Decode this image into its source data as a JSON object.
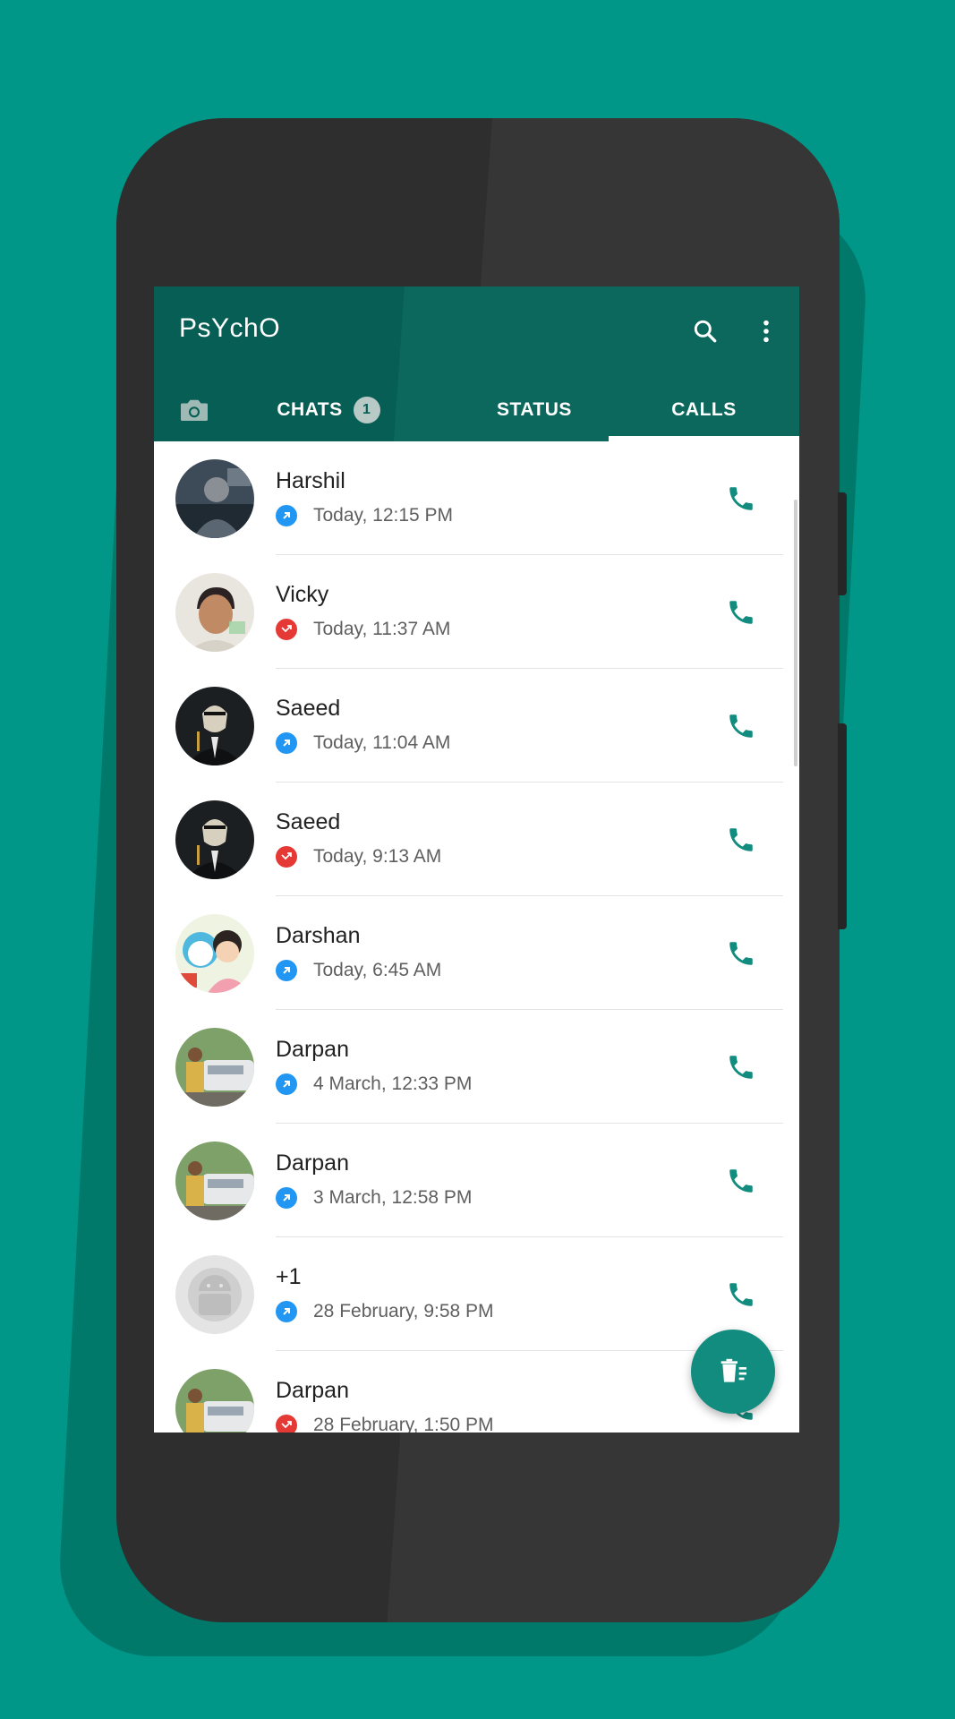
{
  "app": {
    "title": "PsYchO",
    "colors": {
      "primary": "#075e54",
      "accent": "#128c7e",
      "background": "#009688",
      "missed": "#e53935",
      "outgoing": "#2196f3"
    }
  },
  "toolbar": {
    "icons": [
      "search-icon",
      "more-vert-icon"
    ]
  },
  "tabs": {
    "camera_icon": "camera-icon",
    "items": [
      {
        "label": "CHATS",
        "badge": "1"
      },
      {
        "label": "STATUS"
      },
      {
        "label": "CALLS",
        "selected": true
      }
    ]
  },
  "calls": [
    {
      "name": "Harshil",
      "time": "Today, 12:15 PM",
      "direction": "outgoing",
      "icon": "outgoing-call-icon"
    },
    {
      "name": "Vicky",
      "time": "Today, 11:37 AM",
      "direction": "missed",
      "icon": "missed-call-icon"
    },
    {
      "name": "Saeed",
      "time": "Today, 11:04 AM",
      "direction": "outgoing",
      "icon": "outgoing-call-icon"
    },
    {
      "name": "Saeed",
      "time": "Today, 9:13 AM",
      "direction": "missed",
      "icon": "missed-call-icon"
    },
    {
      "name": "Darshan",
      "time": "Today, 6:45 AM",
      "direction": "outgoing",
      "icon": "outgoing-call-icon"
    },
    {
      "name": "Darpan",
      "time": "4 March, 12:33 PM",
      "direction": "outgoing",
      "icon": "outgoing-call-icon"
    },
    {
      "name": "Darpan",
      "time": "3 March, 12:58 PM",
      "direction": "outgoing",
      "icon": "outgoing-call-icon"
    },
    {
      "name": "+1",
      "time": "28 February, 9:58 PM",
      "direction": "outgoing",
      "icon": "outgoing-call-icon"
    },
    {
      "name": "Darpan",
      "time": "28 February, 1:50 PM",
      "direction": "missed",
      "icon": "missed-call-icon"
    }
  ],
  "fab": {
    "icon": "clear-call-log-icon"
  }
}
